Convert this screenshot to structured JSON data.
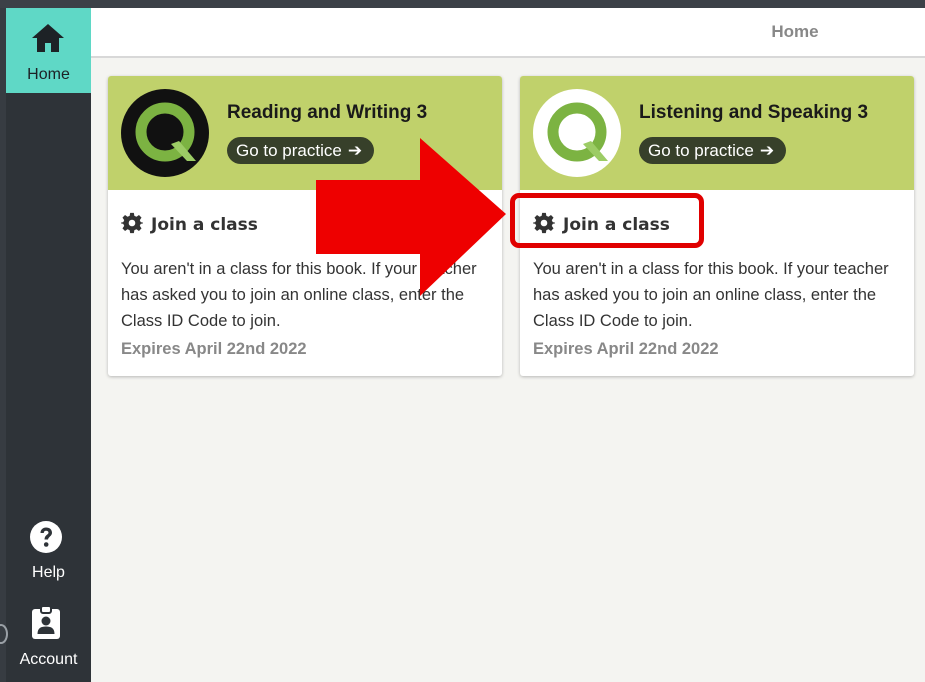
{
  "sidebar": {
    "home": {
      "label": "Home",
      "icon": "home-icon"
    },
    "help": {
      "label": "Help",
      "icon": "question-circle-icon"
    },
    "account": {
      "label": "Account",
      "icon": "id-badge-icon"
    }
  },
  "header": {
    "title": "Home"
  },
  "cards": [
    {
      "title": "Reading and Writing 3",
      "practice_label": "Go to practice",
      "join_label": "Join a class",
      "description": "You aren't in a class for this book. If your teacher has asked you to join an online class, enter the Class ID Code to join.",
      "expires": "Expires April 22nd 2022",
      "logo_style": "dark"
    },
    {
      "title": "Listening and Speaking 3",
      "practice_label": "Go to practice",
      "join_label": "Join a class",
      "description": "You aren't in a class for this book. If your teacher has asked you to join an online class, enter the Class ID Code to join.",
      "expires": "Expires April 22nd 2022",
      "logo_style": "light"
    }
  ],
  "colors": {
    "accent_teal": "#5fd8c6",
    "card_header": "#c0d16b",
    "practice_button": "#37402a",
    "annotation_red": "#e00000"
  }
}
